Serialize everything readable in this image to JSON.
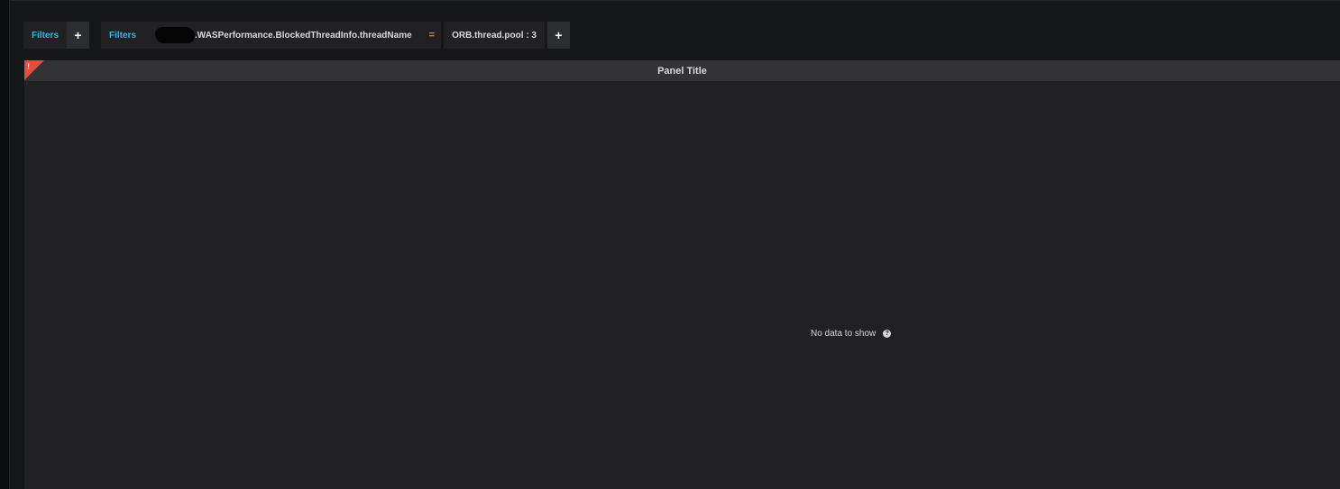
{
  "filters": {
    "group1": {
      "label": "Filters",
      "add_symbol": "+"
    },
    "group2": {
      "label": "Filters",
      "key": ".WASPerformance.BlockedThreadInfo.threadName",
      "operator": "=",
      "value": "ORB.thread.pool : 3",
      "add_symbol": "+"
    }
  },
  "panel": {
    "title": "Panel Title",
    "corner_symbol": "!",
    "empty_message": "No data to show",
    "help_symbol": "?",
    "corner_color": "#e24d42"
  },
  "colors": {
    "filter_label": "#33b5e5",
    "operator": "#eb7b18",
    "background": "#161719",
    "panel_bg": "#212124"
  },
  "icons": {
    "add": "plus-icon",
    "help": "question-circle-icon",
    "error": "exclamation-icon"
  }
}
